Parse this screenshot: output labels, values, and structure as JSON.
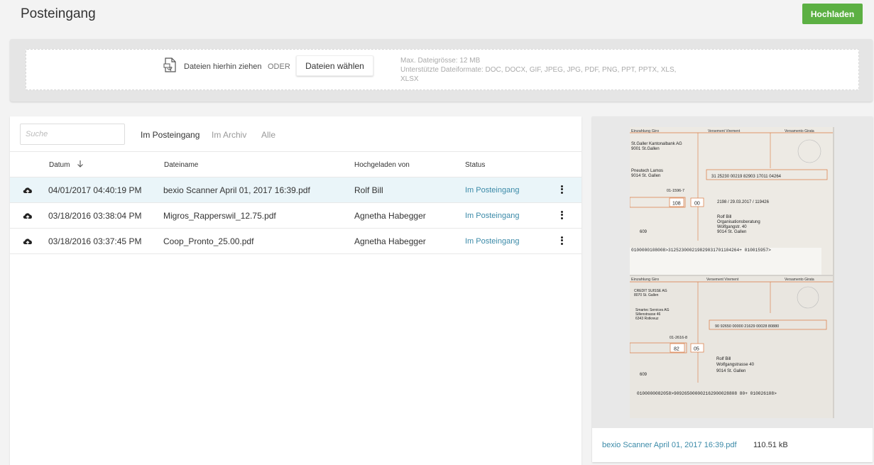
{
  "header": {
    "title": "Posteingang",
    "upload_label": "Hochladen"
  },
  "dropzone": {
    "drag_text": "Dateien hierhin ziehen",
    "or_text": "ODER",
    "choose_label": "Dateien wählen",
    "max_size": "Max. Dateigrösse: 12 MB",
    "formats_line1": "Unterstützte Dateiformate: DOC, DOCX, GIF, JPEG, JPG, PDF, PNG, PPT, PPTX, XLS,",
    "formats_line2": "XLSX"
  },
  "list": {
    "search_placeholder": "Suche",
    "tabs": [
      {
        "label": "Im Posteingang",
        "active": true
      },
      {
        "label": "Im Archiv",
        "active": false
      },
      {
        "label": "Alle",
        "active": false
      }
    ],
    "columns": {
      "date": "Datum",
      "filename": "Dateiname",
      "uploaded_by": "Hochgeladen von",
      "status": "Status"
    },
    "rows": [
      {
        "date": "04/01/2017 04:40:19 PM",
        "filename": "bexio Scanner April 01, 2017 16:39.pdf",
        "uploaded_by": "Rolf Bill",
        "status": "Im Posteingang",
        "selected": true
      },
      {
        "date": "03/18/2016 03:38:04 PM",
        "filename": "Migros_Rapperswil_12.75.pdf",
        "uploaded_by": "Agnetha Habegger",
        "status": "Im Posteingang",
        "selected": false
      },
      {
        "date": "03/18/2016 03:37:45 PM",
        "filename": "Coop_Pronto_25.00.pdf",
        "uploaded_by": "Agnetha Habegger",
        "status": "Im Posteingang",
        "selected": false
      }
    ]
  },
  "preview": {
    "filename": "bexio Scanner April 01, 2017 16:39.pdf",
    "filesize": "110.51 kB",
    "slip1": {
      "header_left": "Einzahlung Giro",
      "header_mid": "Versement Virement",
      "header_right": "Versamento Girata",
      "bank": "St.Galler Kantonalbank AG",
      "bank_city": "9001 St.Gallen",
      "sender": "Pneutech Lamos",
      "sender_city": "9014 St. Gallen",
      "account": "01-1596-7",
      "ref": "31 25230 00219 82903 17011 04264",
      "amount": "108",
      "cents": "00",
      "note": "2198 / 29.03.2017 / 119426",
      "payer1": "Rolf Bill",
      "payer2": "Organisationsberatung",
      "payer3": "Wolfgangstr. 40",
      "payer4": "9014 St. Gallen",
      "code": "609",
      "ocr": "0100000108008>312523000219829031701104264+ 010015957>"
    },
    "slip2": {
      "header_left": "Einzahlung Giro",
      "header_mid": "Versement Virement",
      "header_right": "Versamento Girata",
      "bank": "CREDIT SUISSE AG",
      "bank_city": "8070 St. Gallen",
      "sender": "Smartec Services AG",
      "sender_street": "Sillenstrasse 46",
      "sender_city": "6343 Rotkreuz",
      "account": "01-2616-8",
      "ref": "90   92650   00000   21629   00028   80880",
      "amount": "82",
      "cents": "05",
      "payer1": "Rolf Bill",
      "payer2": "Wolfgangstrasse 40",
      "payer3": "9014   St. Gallen",
      "code": "609",
      "ocr": "0100000082058>909265000002162900028808 80+ 010026108>"
    }
  },
  "colors": {
    "accent_green": "#5cb043",
    "link_blue": "#3b8aa8",
    "selected_row": "#eaf5f9",
    "slip_orange": "#d9773f"
  }
}
